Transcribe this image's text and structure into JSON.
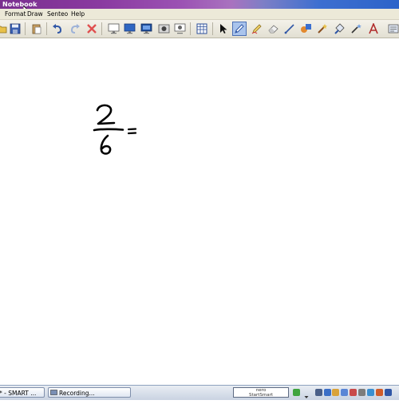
{
  "window": {
    "title": "Notebook"
  },
  "menu": {
    "items": [
      {
        "label": "Format"
      },
      {
        "label": "Draw"
      },
      {
        "label": "Senteo"
      },
      {
        "label": "Help"
      }
    ]
  },
  "toolbar": {
    "buttons": [
      "folder-icon",
      "save-icon",
      "paste-icon",
      "undo-icon",
      "redo-icon",
      "delete-icon",
      "screen-shade-icon",
      "monitor-icon",
      "display-icon",
      "capture-icon",
      "record-icon",
      "table-icon",
      "select-arrow-icon",
      "pen-icon",
      "creative-pen-icon",
      "eraser-icon",
      "line-icon",
      "shapes-icon",
      "magic-pen-icon",
      "fill-icon",
      "text-icon",
      "properties-icon"
    ],
    "active_tool": "pen-icon"
  },
  "canvas": {
    "ink": {
      "numerator": "2",
      "denominator": "6",
      "operator": "="
    }
  },
  "taskbar": {
    "tasks": [
      {
        "label": "* - SMART ..."
      },
      {
        "label": "Recording..."
      }
    ],
    "nero_label": "nero\nStartSmart"
  },
  "colors": {
    "titlebar_start": "#7a2f8f",
    "titlebar_end": "#2c63c9",
    "toolbar_active": "#aac4ec",
    "taskbar": "#c9d3e2"
  }
}
